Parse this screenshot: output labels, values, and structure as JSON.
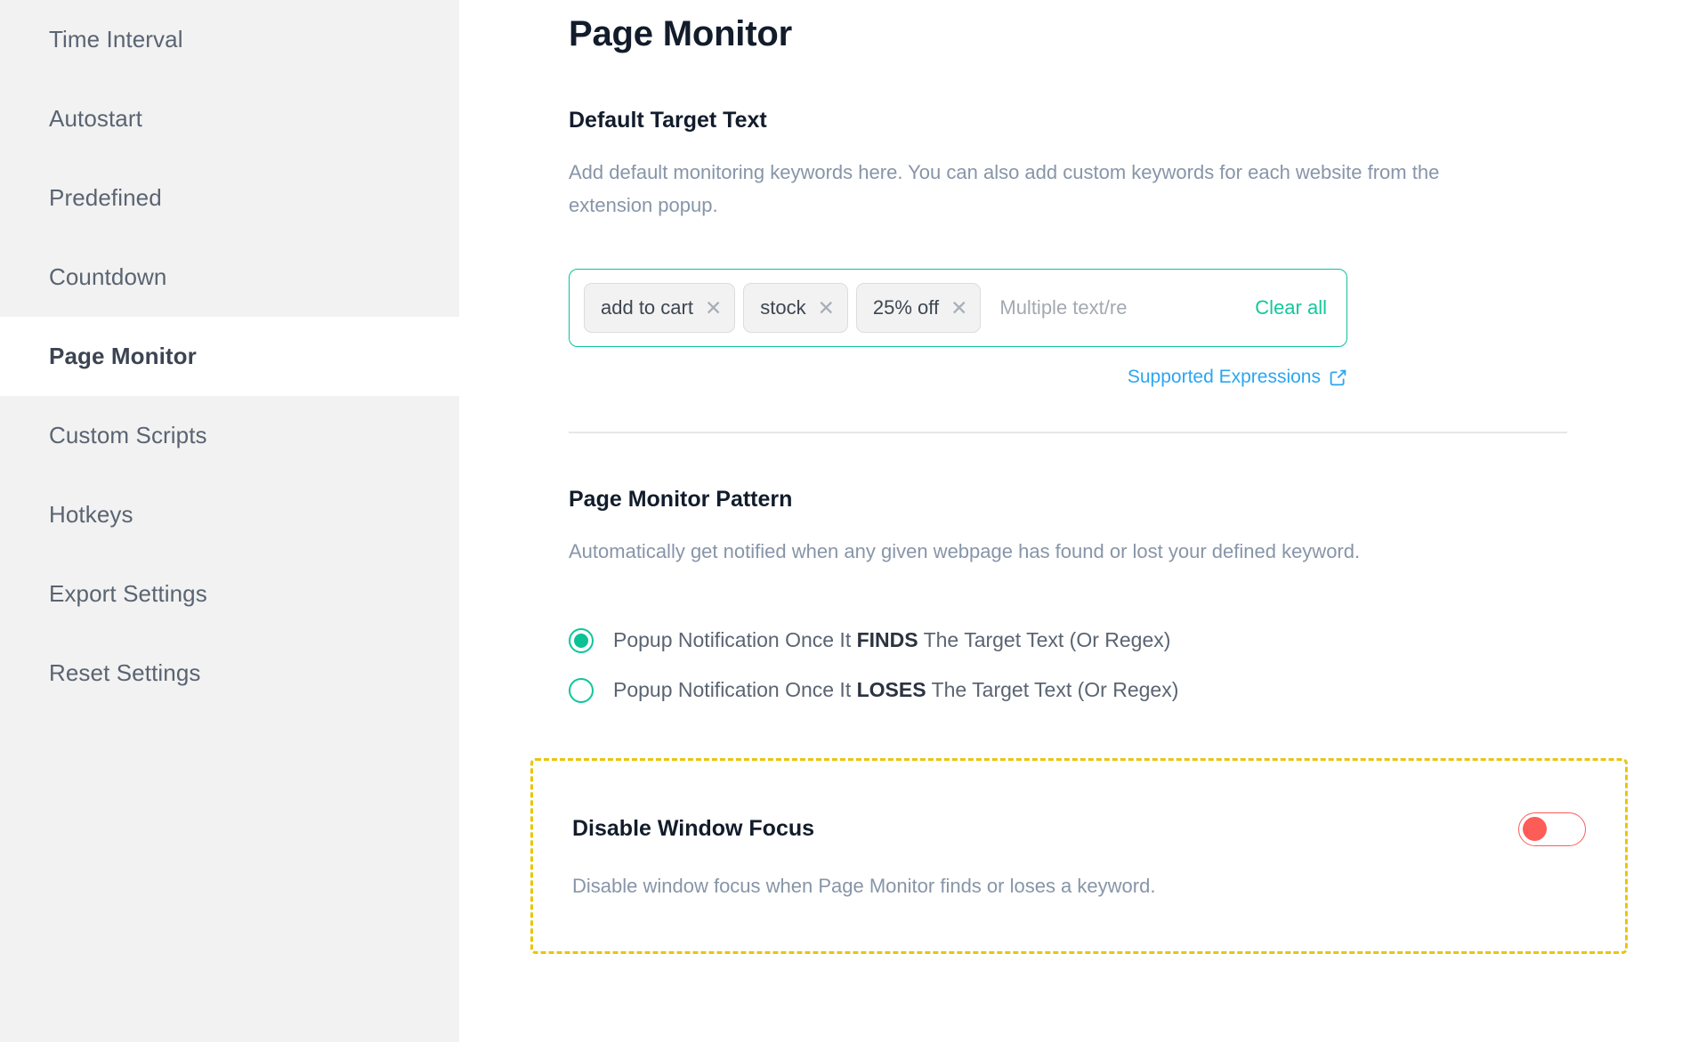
{
  "sidebar": {
    "items": [
      {
        "label": "Time Interval",
        "active": false
      },
      {
        "label": "Autostart",
        "active": false
      },
      {
        "label": "Predefined",
        "active": false
      },
      {
        "label": "Countdown",
        "active": false
      },
      {
        "label": "Page Monitor",
        "active": true
      },
      {
        "label": "Custom Scripts",
        "active": false
      },
      {
        "label": "Hotkeys",
        "active": false
      },
      {
        "label": "Export Settings",
        "active": false
      },
      {
        "label": "Reset Settings",
        "active": false
      }
    ]
  },
  "main": {
    "page_title": "Page Monitor",
    "default_target_text": {
      "title": "Default Target Text",
      "description": "Add default monitoring keywords here. You can also add custom keywords for each website from the extension popup.",
      "tags": [
        {
          "label": "add to cart",
          "remove": "✕"
        },
        {
          "label": "stock",
          "remove": "✕"
        },
        {
          "label": "25% off",
          "remove": "✕"
        }
      ],
      "input_placeholder": "Multiple text/re",
      "input_value": "",
      "clear_all_label": "Clear all",
      "supported_expressions_label": "Supported Expressions",
      "supported_expressions_icon": "external-link-icon"
    },
    "page_monitor_pattern": {
      "title": "Page Monitor Pattern",
      "description": "Automatically get notified when any given webpage has found or lost your defined keyword.",
      "options": [
        {
          "prefix": "Popup Notification Once It ",
          "emphasis": "FINDS",
          "suffix": " The Target Text (Or Regex)",
          "selected": true
        },
        {
          "prefix": "Popup Notification Once It ",
          "emphasis": "LOSES",
          "suffix": " The Target Text (Or Regex)",
          "selected": false
        }
      ]
    },
    "disable_window_focus": {
      "title": "Disable Window Focus",
      "description": "Disable window focus when Page Monitor finds or loses a keyword.",
      "toggle_state": "off"
    }
  },
  "colors": {
    "accent_green": "#0bc294",
    "input_border_green": "#08c39d",
    "link_blue": "#2ba6f0",
    "highlight_yellow": "#e8c511",
    "toggle_red": "#fd5c57",
    "sidebar_bg": "#f2f2f2",
    "muted_text": "#8795a8",
    "heading_text": "#121c2b"
  }
}
